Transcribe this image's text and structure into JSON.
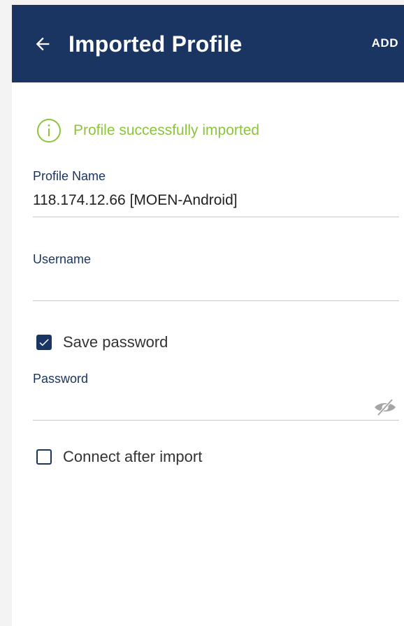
{
  "appbar": {
    "title": "Imported Profile",
    "add_label": "ADD",
    "back_icon": "arrow-left-icon",
    "background": "#1b3562"
  },
  "status": {
    "message": "Profile successfully imported",
    "icon": "info-circle-icon",
    "color": "#8cc43b"
  },
  "fields": {
    "profile_name": {
      "label": "Profile Name",
      "value": "118.174.12.66 [MOEN-Android]"
    },
    "username": {
      "label": "Username",
      "value": ""
    },
    "password": {
      "label": "Password",
      "value": "",
      "visibility_icon": "eye-off-icon"
    }
  },
  "checkboxes": {
    "save_password": {
      "label": "Save password",
      "checked": true
    },
    "connect_after_import": {
      "label": "Connect after import",
      "checked": false
    }
  }
}
